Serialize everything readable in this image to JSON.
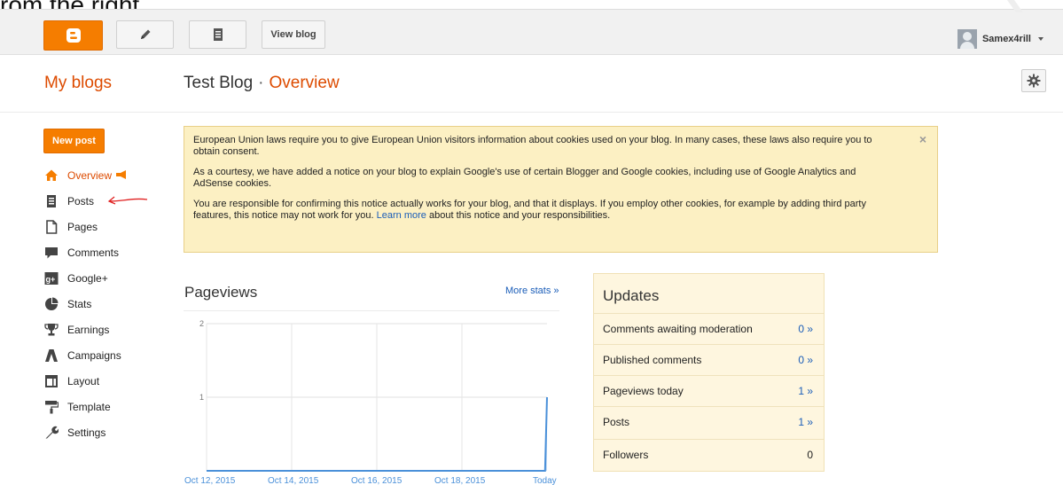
{
  "caption": "rom the right",
  "topbar": {
    "view_blog_label": "View blog",
    "username": "Samex4rill",
    "icons": [
      "blogger-logo-icon",
      "pencil-icon",
      "posts-list-icon",
      "avatar",
      "caret-down-icon"
    ]
  },
  "header": {
    "my_blogs": "My blogs",
    "blog_name": "Test Blog",
    "separator": "·",
    "section": "Overview"
  },
  "sidebar": {
    "new_post_label": "New post",
    "items": [
      {
        "label": "Overview",
        "icon": "home-icon"
      },
      {
        "label": "Posts",
        "icon": "posts-icon"
      },
      {
        "label": "Pages",
        "icon": "pages-icon"
      },
      {
        "label": "Comments",
        "icon": "comments-icon"
      },
      {
        "label": "Google+",
        "icon": "google-plus-icon"
      },
      {
        "label": "Stats",
        "icon": "stats-icon"
      },
      {
        "label": "Earnings",
        "icon": "trophy-icon"
      },
      {
        "label": "Campaigns",
        "icon": "campaigns-icon"
      },
      {
        "label": "Layout",
        "icon": "layout-icon"
      },
      {
        "label": "Template",
        "icon": "paint-roller-icon"
      },
      {
        "label": "Settings",
        "icon": "wrench-icon"
      }
    ]
  },
  "notice": {
    "p1": "European Union laws require you to give European Union visitors information about cookies used on your blog. In many cases, these laws also require you to obtain consent.",
    "p2": "As a courtesy, we have added a notice on your blog to explain Google's use of certain Blogger and Google cookies, including use of Google Analytics and AdSense cookies.",
    "p3_before": "You are responsible for confirming this notice actually works for your blog, and that it displays. If you employ other cookies, for example by adding third party features, this notice may not work for you.",
    "p3_link": "Learn more",
    "p3_after": "about this notice and your responsibilities.",
    "close": "×"
  },
  "pageviews": {
    "title": "Pageviews",
    "more_stats": "More stats »"
  },
  "chart_data": {
    "type": "area",
    "x": [
      "Oct 12, 2015",
      "Oct 14, 2015",
      "Oct 16, 2015",
      "Oct 18, 2015",
      "Today"
    ],
    "y_ticks": [
      "2",
      "1"
    ],
    "ylim": [
      0,
      2
    ],
    "series": [
      {
        "values": [
          0,
          0,
          0,
          0,
          0,
          0,
          0,
          0,
          0,
          0,
          0,
          0,
          0,
          0,
          0,
          0,
          0,
          0,
          0,
          0,
          0,
          0,
          0,
          0,
          0,
          0,
          0,
          0,
          0,
          0,
          0,
          0,
          0,
          0,
          0,
          0,
          0,
          0,
          0,
          0,
          0,
          0,
          0,
          0,
          0,
          0,
          0,
          0,
          0,
          0,
          0,
          0,
          0,
          0,
          0,
          0,
          0,
          0,
          0,
          0,
          0,
          0,
          0,
          0,
          0,
          0,
          0,
          0,
          0,
          0,
          0,
          0,
          0,
          0,
          0,
          0,
          0,
          0,
          0,
          0,
          0,
          0,
          0,
          0,
          0,
          0,
          0,
          0,
          0,
          0,
          0,
          0,
          0,
          0,
          0,
          0,
          0,
          0,
          0,
          0,
          0,
          0,
          0,
          0,
          0,
          0,
          0,
          0,
          0,
          0,
          0,
          0,
          0,
          0,
          0,
          0,
          0,
          0,
          0,
          0,
          0,
          0,
          0,
          0,
          0,
          0,
          0,
          0,
          0,
          0,
          0,
          0,
          0,
          0,
          0,
          0,
          0,
          0,
          0,
          0,
          0,
          0,
          0,
          0,
          0,
          0,
          0,
          0,
          0,
          0,
          0,
          0,
          0,
          0,
          0,
          0,
          0,
          0,
          0,
          0,
          0,
          0,
          0,
          0,
          0,
          0,
          0,
          0,
          0,
          0,
          0,
          0,
          0,
          0,
          0,
          0,
          0,
          1
        ]
      }
    ],
    "grid": true,
    "color": "#4a90d9",
    "fill": "#c6dcf3"
  },
  "updates": {
    "title": "Updates",
    "rows": [
      {
        "label": "Comments awaiting moderation",
        "value": "0 »"
      },
      {
        "label": "Published comments",
        "value": "0 »"
      },
      {
        "label": "Pageviews today",
        "value": "1 »"
      },
      {
        "label": "Posts",
        "value": "1 »"
      },
      {
        "label": "Followers",
        "value": "0"
      }
    ]
  },
  "colors": {
    "accent": "#f57d00",
    "title_orange": "#dd4b00",
    "link": "#1a5db8",
    "notice_bg": "#fcf0c3",
    "updates_bg": "#fef6df"
  }
}
